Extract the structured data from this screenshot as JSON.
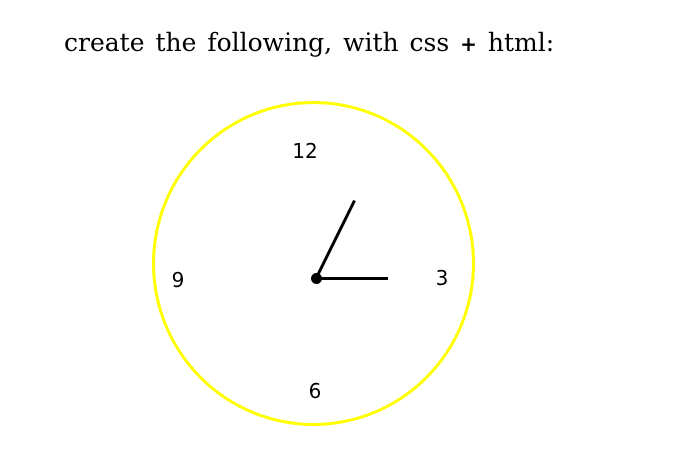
{
  "prompt": {
    "before": "create the following, with css",
    "plus": "+",
    "after": "html:"
  },
  "clock": {
    "ring_color": "#ffff00",
    "numerals": {
      "twelve": "12",
      "three": "3",
      "six": "6",
      "nine": "9"
    }
  }
}
